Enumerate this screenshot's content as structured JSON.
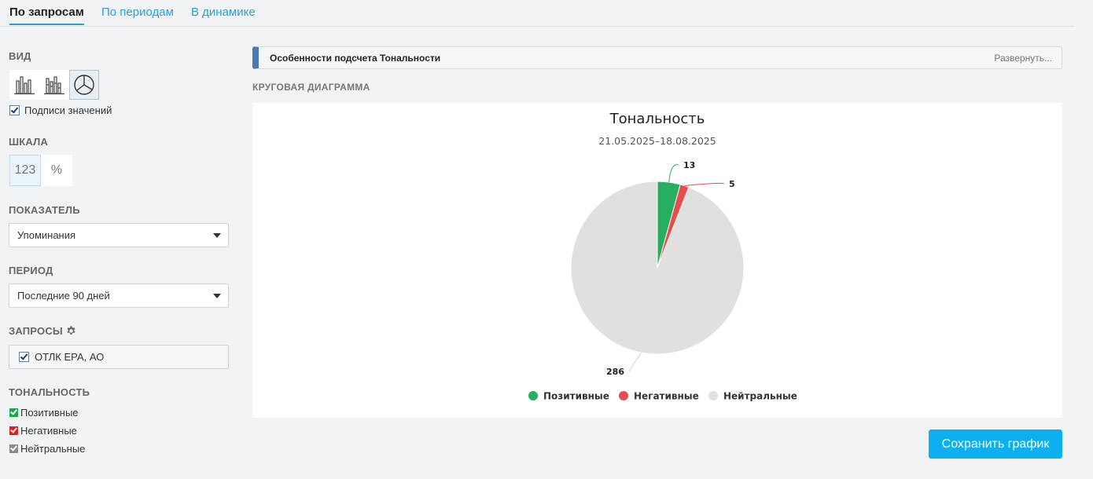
{
  "tabs": [
    {
      "label": "По запросам",
      "active": true
    },
    {
      "label": "По периодам",
      "active": false
    },
    {
      "label": "В динамике",
      "active": false
    }
  ],
  "sidebar": {
    "view": {
      "title": "ВИД",
      "value_labels": "Подписи значений"
    },
    "scale": {
      "title": "ШКАЛА",
      "absolute": "123",
      "percent": "%"
    },
    "metric": {
      "title": "ПОКАЗАТЕЛЬ",
      "selected": "Упоминания"
    },
    "period": {
      "title": "ПЕРИОД",
      "selected": "Последние 90 дней"
    },
    "queries": {
      "title": "ЗАПРОСЫ",
      "items": [
        "ОТЛК ЕРА, АО"
      ]
    },
    "tonality": {
      "title": "ТОНАЛЬНОСТЬ",
      "items": [
        {
          "label": "Позитивные",
          "color": "#1aa84c"
        },
        {
          "label": "Негативные",
          "color": "#e02020"
        },
        {
          "label": "Нейтральные",
          "color": "#8a8a8a"
        }
      ]
    }
  },
  "notice": {
    "title": "Особенности подсчета Тональности",
    "expand": "Развернуть..."
  },
  "chart_section_label": "КРУГОВАЯ ДИАГРАММА",
  "chart_data": {
    "type": "pie",
    "title": "Тональность",
    "subtitle": "21.05.2025–18.08.2025",
    "categories": [
      "Позитивные",
      "Негативные",
      "Нейтральные"
    ],
    "values": [
      13,
      5,
      286
    ],
    "colors": [
      "#27ae60",
      "#e84d4d",
      "#e0e0e0"
    ],
    "legend": "bottom"
  },
  "save_button": "Сохранить график"
}
